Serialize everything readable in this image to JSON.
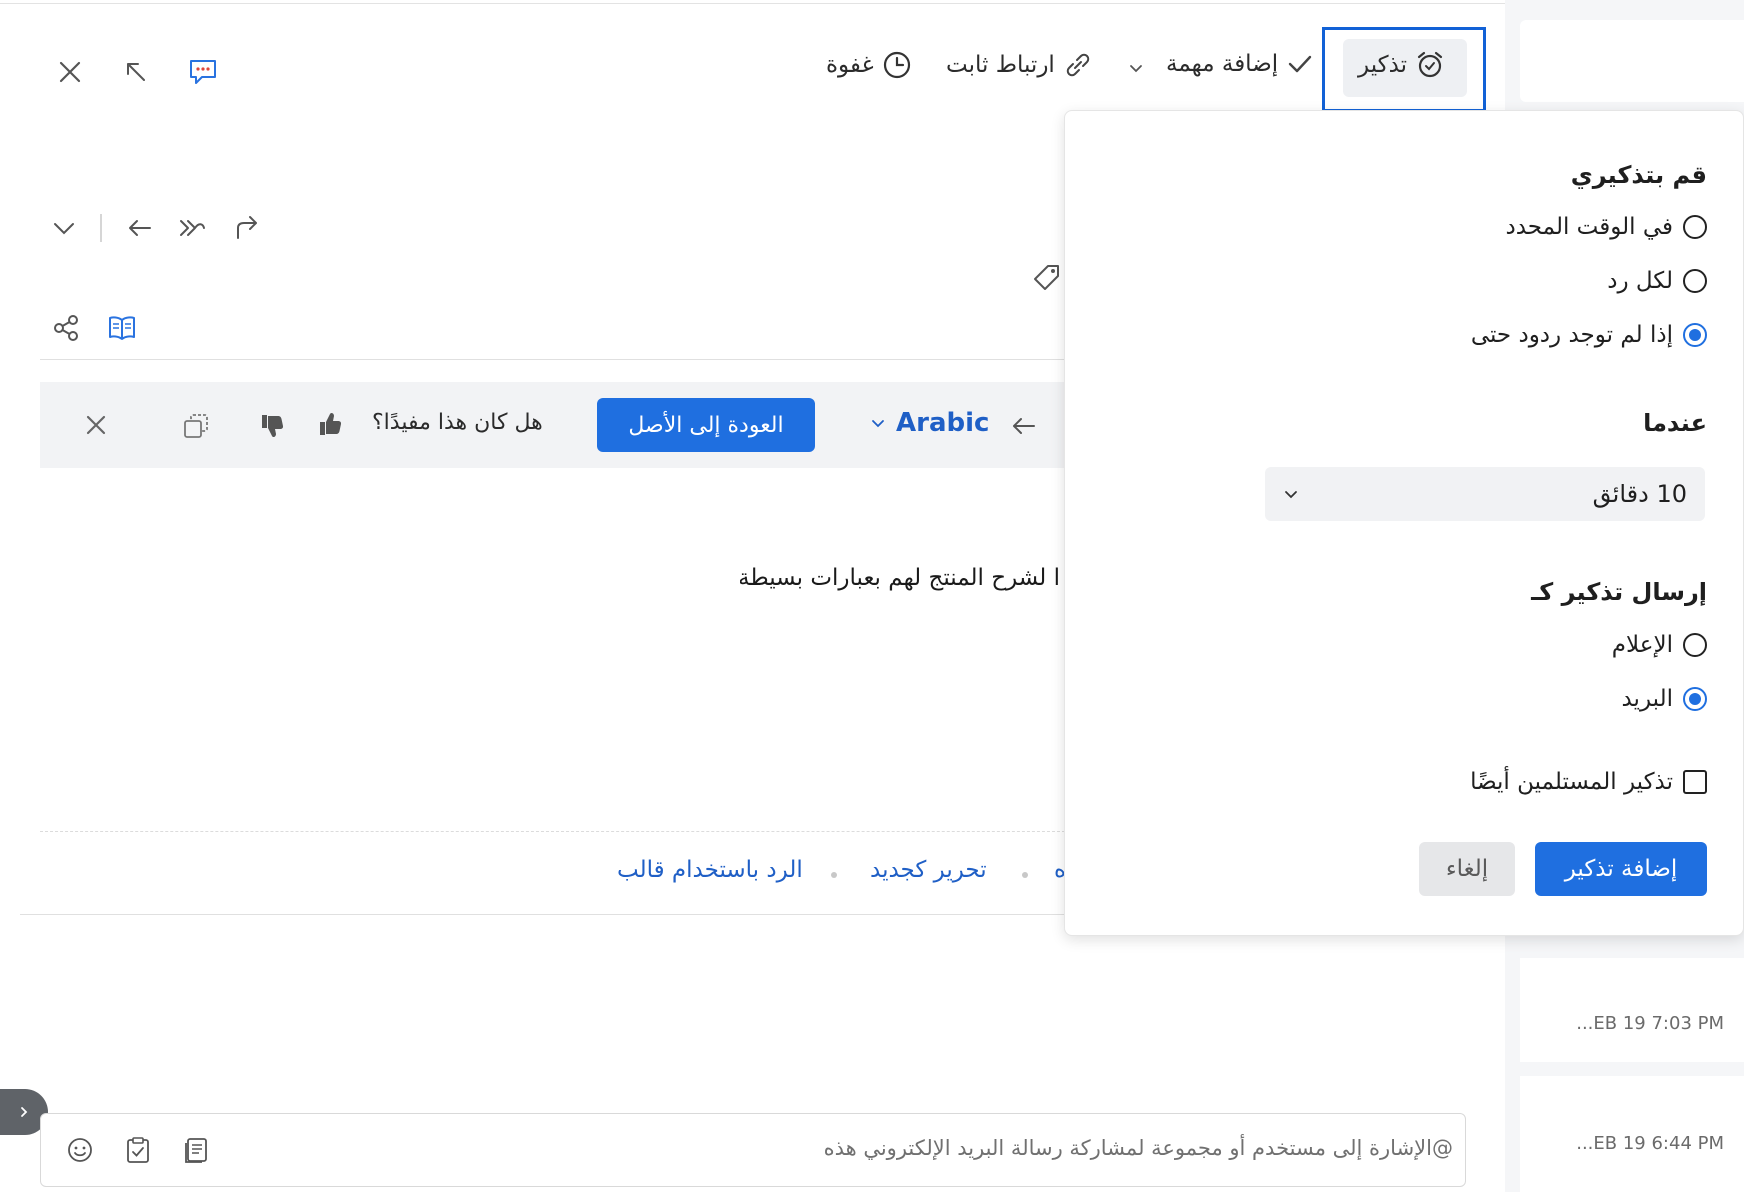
{
  "toolbar": {
    "snooze_label": "غفوة",
    "permalink_label": "ارتباط ثابت",
    "add_task_label": "إضافة مهمة",
    "remind_label": "تذكير"
  },
  "translate_bar": {
    "language": "Arabic",
    "back_to_original": "العودة إلى الأصل",
    "helpful_question": "هل كان هذا مفيدًا؟"
  },
  "message": {
    "body_text": "ا لشرح المنتج لهم بعبارات بسيطة."
  },
  "reply_links": {
    "reply_with_template": "الرد باستخدام قالب",
    "edit_as_new": "تحرير كجديد",
    "partial": "ه"
  },
  "reminder_popover": {
    "remind_me_heading": "قم بتذكيري",
    "options": [
      {
        "label": "في الوقت المحدد",
        "selected": false
      },
      {
        "label": "لكل رد",
        "selected": false
      },
      {
        "label": "إذا لم توجد ردود حتى",
        "selected": true
      }
    ],
    "when_heading": "عندما",
    "when_value": "10 دقائق",
    "send_as_heading": "إرسال تذكير كـ",
    "send_options": [
      {
        "label": "الإعلام",
        "selected": false
      },
      {
        "label": "البريد",
        "selected": true
      }
    ],
    "remind_recipients_label": "تذكير المستلمين أيضًا",
    "remind_recipients_checked": false,
    "add_button": "إضافة تذكير",
    "cancel_button": "إلغاء"
  },
  "sidebar": {
    "times": [
      "...EB 19 7:03 PM",
      "...EB 19 6:44 PM"
    ]
  },
  "comment": {
    "placeholder": "@الإشارة إلى مستخدم أو مجموعة لمشاركة رسالة البريد الإلكتروني هذه"
  },
  "colors": {
    "accent": "#1f6fe0",
    "highlight_border": "#1161d6",
    "link": "#1f5fc6"
  }
}
